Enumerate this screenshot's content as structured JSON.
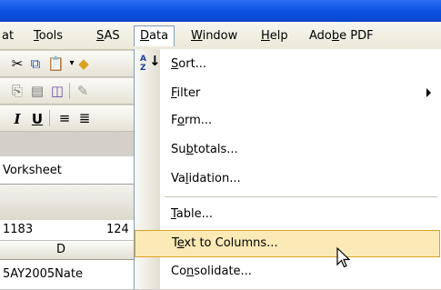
{
  "menubar": {
    "items": [
      {
        "pre": "",
        "u": "",
        "post": "at"
      },
      {
        "pre": "",
        "u": "T",
        "post": "ools"
      },
      {
        "pre": "",
        "u": "S",
        "post": "AS"
      },
      {
        "pre": "",
        "u": "D",
        "post": "ata"
      },
      {
        "pre": "",
        "u": "W",
        "post": "indow"
      },
      {
        "pre": "",
        "u": "H",
        "post": "elp"
      },
      {
        "pre": "Ado",
        "u": "b",
        "post": "e PDF"
      }
    ]
  },
  "toolbar": {
    "format_labels": {
      "italic": "I",
      "underline": "U"
    }
  },
  "namebox": {
    "text": "Vorksheet"
  },
  "cells": {
    "row1_a": "1183",
    "row1_b": "124",
    "col_header": "D",
    "row3": "5AY2005Nate"
  },
  "data_menu": {
    "items": [
      {
        "pre": "",
        "u": "S",
        "post": "ort..."
      },
      {
        "pre": "",
        "u": "F",
        "post": "ilter"
      },
      {
        "pre": "F",
        "u": "o",
        "post": "rm..."
      },
      {
        "pre": "Su",
        "u": "b",
        "post": "totals..."
      },
      {
        "pre": "Va",
        "u": "l",
        "post": "idation..."
      },
      {
        "pre": "",
        "u": "T",
        "post": "able..."
      },
      {
        "pre": "T",
        "u": "e",
        "post": "xt to Columns..."
      },
      {
        "pre": "Co",
        "u": "n",
        "post": "solidate..."
      }
    ],
    "highlighted": "Text to Columns..."
  },
  "icons": {
    "sort": "sort-az-icon",
    "submenu": "submenu-arrow-icon",
    "cursor": "mouse-pointer-icon"
  }
}
